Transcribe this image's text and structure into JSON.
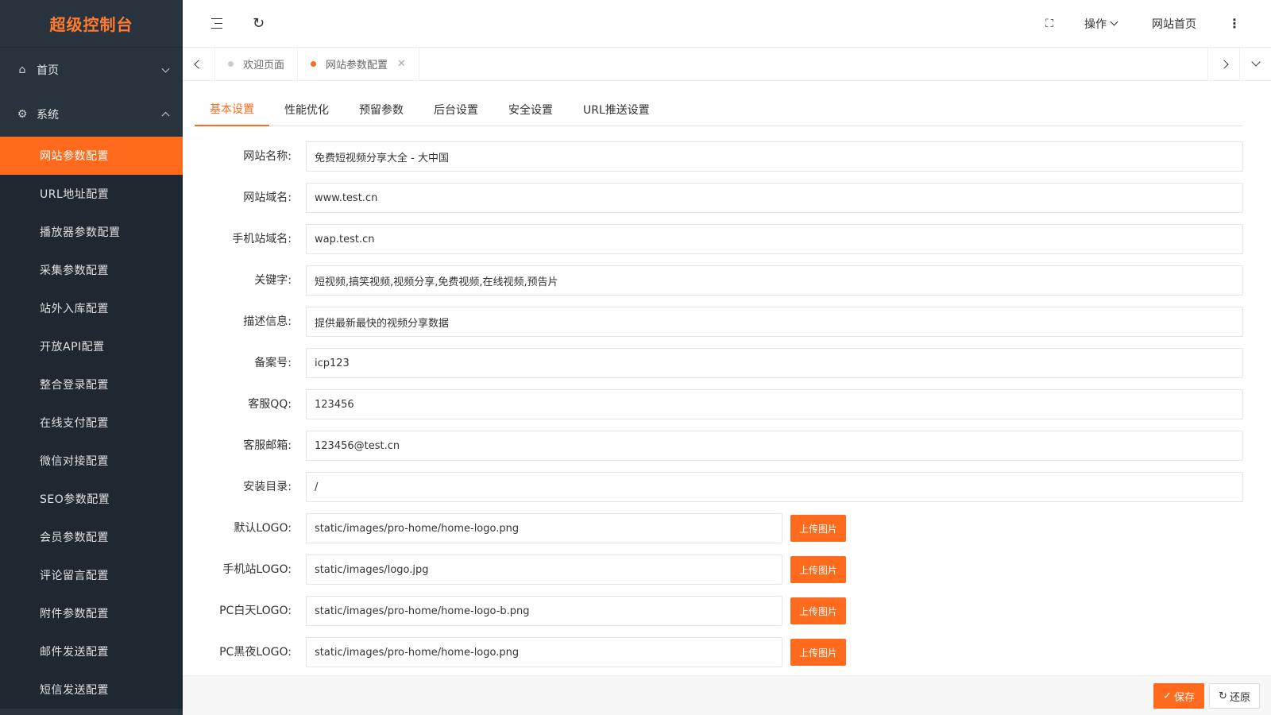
{
  "app": {
    "title": "超级控制台"
  },
  "sidebar": {
    "menus": [
      {
        "label": "首页",
        "icon": "home-icon"
      },
      {
        "label": "系统",
        "icon": "settings-icon"
      }
    ],
    "items": [
      {
        "label": "网站参数配置"
      },
      {
        "label": "URL地址配置"
      },
      {
        "label": "播放器参数配置"
      },
      {
        "label": "采集参数配置"
      },
      {
        "label": "站外入库配置"
      },
      {
        "label": "开放API配置"
      },
      {
        "label": "整合登录配置"
      },
      {
        "label": "在线支付配置"
      },
      {
        "label": "微信对接配置"
      },
      {
        "label": "SEO参数配置"
      },
      {
        "label": "会员参数配置"
      },
      {
        "label": "评论留言配置"
      },
      {
        "label": "附件参数配置"
      },
      {
        "label": "邮件发送配置"
      },
      {
        "label": "短信发送配置"
      }
    ]
  },
  "header": {
    "operations_label": "操作",
    "home_link": "网站首页"
  },
  "tabs": [
    {
      "label": "欢迎页面"
    },
    {
      "label": "网站参数配置"
    }
  ],
  "subtabs": [
    {
      "label": "基本设置"
    },
    {
      "label": "性能优化"
    },
    {
      "label": "预留参数"
    },
    {
      "label": "后台设置"
    },
    {
      "label": "安全设置"
    },
    {
      "label": "URL推送设置"
    }
  ],
  "form": {
    "fields": [
      {
        "label": "网站名称:",
        "value": "免费短视频分享大全 - 大中国"
      },
      {
        "label": "网站域名:",
        "value": "www.test.cn"
      },
      {
        "label": "手机站域名:",
        "value": "wap.test.cn"
      },
      {
        "label": "关键字:",
        "value": "短视频,搞笑视频,视频分享,免费视频,在线视频,预告片"
      },
      {
        "label": "描述信息:",
        "value": "提供最新最快的视频分享数据"
      },
      {
        "label": "备案号:",
        "value": "icp123"
      },
      {
        "label": "客服QQ:",
        "value": "123456"
      },
      {
        "label": "客服邮箱:",
        "value": "123456@test.cn"
      },
      {
        "label": "安装目录:",
        "value": "/"
      }
    ],
    "logos": [
      {
        "label": "默认LOGO:",
        "value": "static/images/pro-home/home-logo.png"
      },
      {
        "label": "手机站LOGO:",
        "value": "static/images/logo.jpg"
      },
      {
        "label": "PC白天LOGO:",
        "value": "static/images/pro-home/home-logo-b.png"
      },
      {
        "label": "PC黑夜LOGO:",
        "value": "static/images/pro-home/home-logo.png"
      }
    ],
    "upload_label": "上传图片"
  },
  "footer": {
    "save_label": "保存",
    "reset_label": "还原"
  },
  "colors": {
    "accent": "#ff6a1c",
    "sidebar_bg": "#28333e",
    "logo_text": "#ff7b2e"
  }
}
